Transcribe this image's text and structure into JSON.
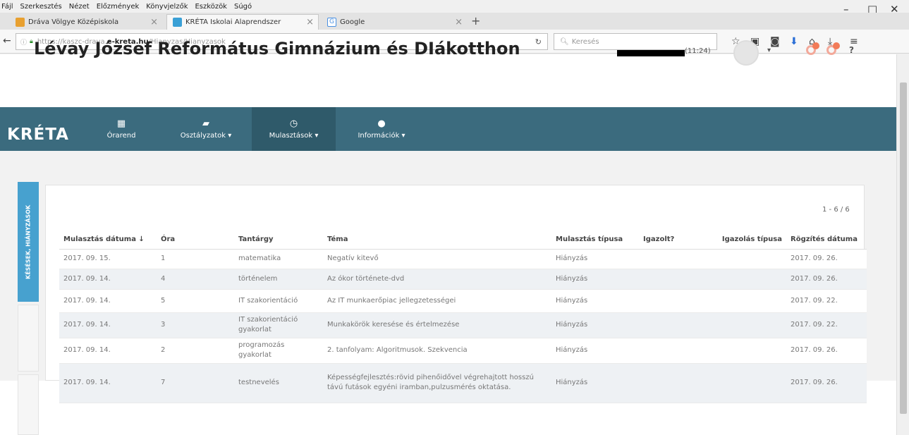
{
  "menubar": [
    "Fájl",
    "Szerkesztés",
    "Nézet",
    "Előzmények",
    "Könyvjelzők",
    "Eszközök",
    "Súgó"
  ],
  "tabs": [
    {
      "label": "Dráva Völgye Középiskola",
      "active": false,
      "color": "#e8a030"
    },
    {
      "label": "KRÉTA Iskolai Alaprendszer",
      "active": true,
      "color": "#3aa0d6"
    },
    {
      "label": "Google",
      "active": false,
      "color": "#fff"
    }
  ],
  "url": {
    "prefix": "https://kaszc-drava.",
    "domain": "e-kreta.hu",
    "path": "/Hianyzas/Hianyzasok"
  },
  "search_placeholder": "Keresés",
  "header": {
    "school": "Lévay József Református Gimnázium és DIákotthon",
    "time": "(11:24)",
    "help": "?"
  },
  "nav": {
    "logo": "KRÉTA",
    "items": [
      {
        "label": "Órarend",
        "icon": "calendar-icon"
      },
      {
        "label": "Osztályzatok ▾",
        "icon": "graduation-cap-icon"
      },
      {
        "label": "Mulasztások ▾",
        "icon": "clock-icon"
      },
      {
        "label": "Információk ▾",
        "icon": "info-icon"
      }
    ]
  },
  "side_tabs": [
    "KÉSÉSEK, HIÁNYZÁSOK",
    "",
    ""
  ],
  "pager": "1 - 6 / 6",
  "table": {
    "headers": [
      "Mulasztás dátuma ↓",
      "Óra",
      "Tantárgy",
      "Téma",
      "Mulasztás típusa",
      "Igazolt?",
      "Igazolás típusa",
      "Rögzítés dátuma"
    ],
    "rows": [
      [
        "2017. 09. 15.",
        "1",
        "matematika",
        "Negatív kitevő",
        "Hiányzás",
        "",
        "",
        "2017. 09. 26."
      ],
      [
        "2017. 09. 14.",
        "4",
        "történelem",
        "Az ókor története-dvd",
        "Hiányzás",
        "",
        "",
        "2017. 09. 26."
      ],
      [
        "2017. 09. 14.",
        "5",
        "IT szakorientáció",
        "Az IT munkaerőpiac jellegzetességei",
        "Hiányzás",
        "",
        "",
        "2017. 09. 22."
      ],
      [
        "2017. 09. 14.",
        "3",
        "IT szakorientáció gyakorlat",
        "Munkakörök keresése és értelmezése",
        "Hiányzás",
        "",
        "",
        "2017. 09. 22."
      ],
      [
        "2017. 09. 14.",
        "2",
        "programozás gyakorlat",
        "2. tanfolyam: Algoritmusok. Szekvencia",
        "Hiányzás",
        "",
        "",
        "2017. 09. 26."
      ],
      [
        "2017. 09. 14.",
        "7",
        "testnevelés",
        "Képességfejlesztés:rövid pihenőidővel végrehajtott hosszú távú futások egyéni iramban,pulzusmérés oktatása.",
        "Hiányzás",
        "",
        "",
        "2017. 09. 26."
      ]
    ]
  }
}
